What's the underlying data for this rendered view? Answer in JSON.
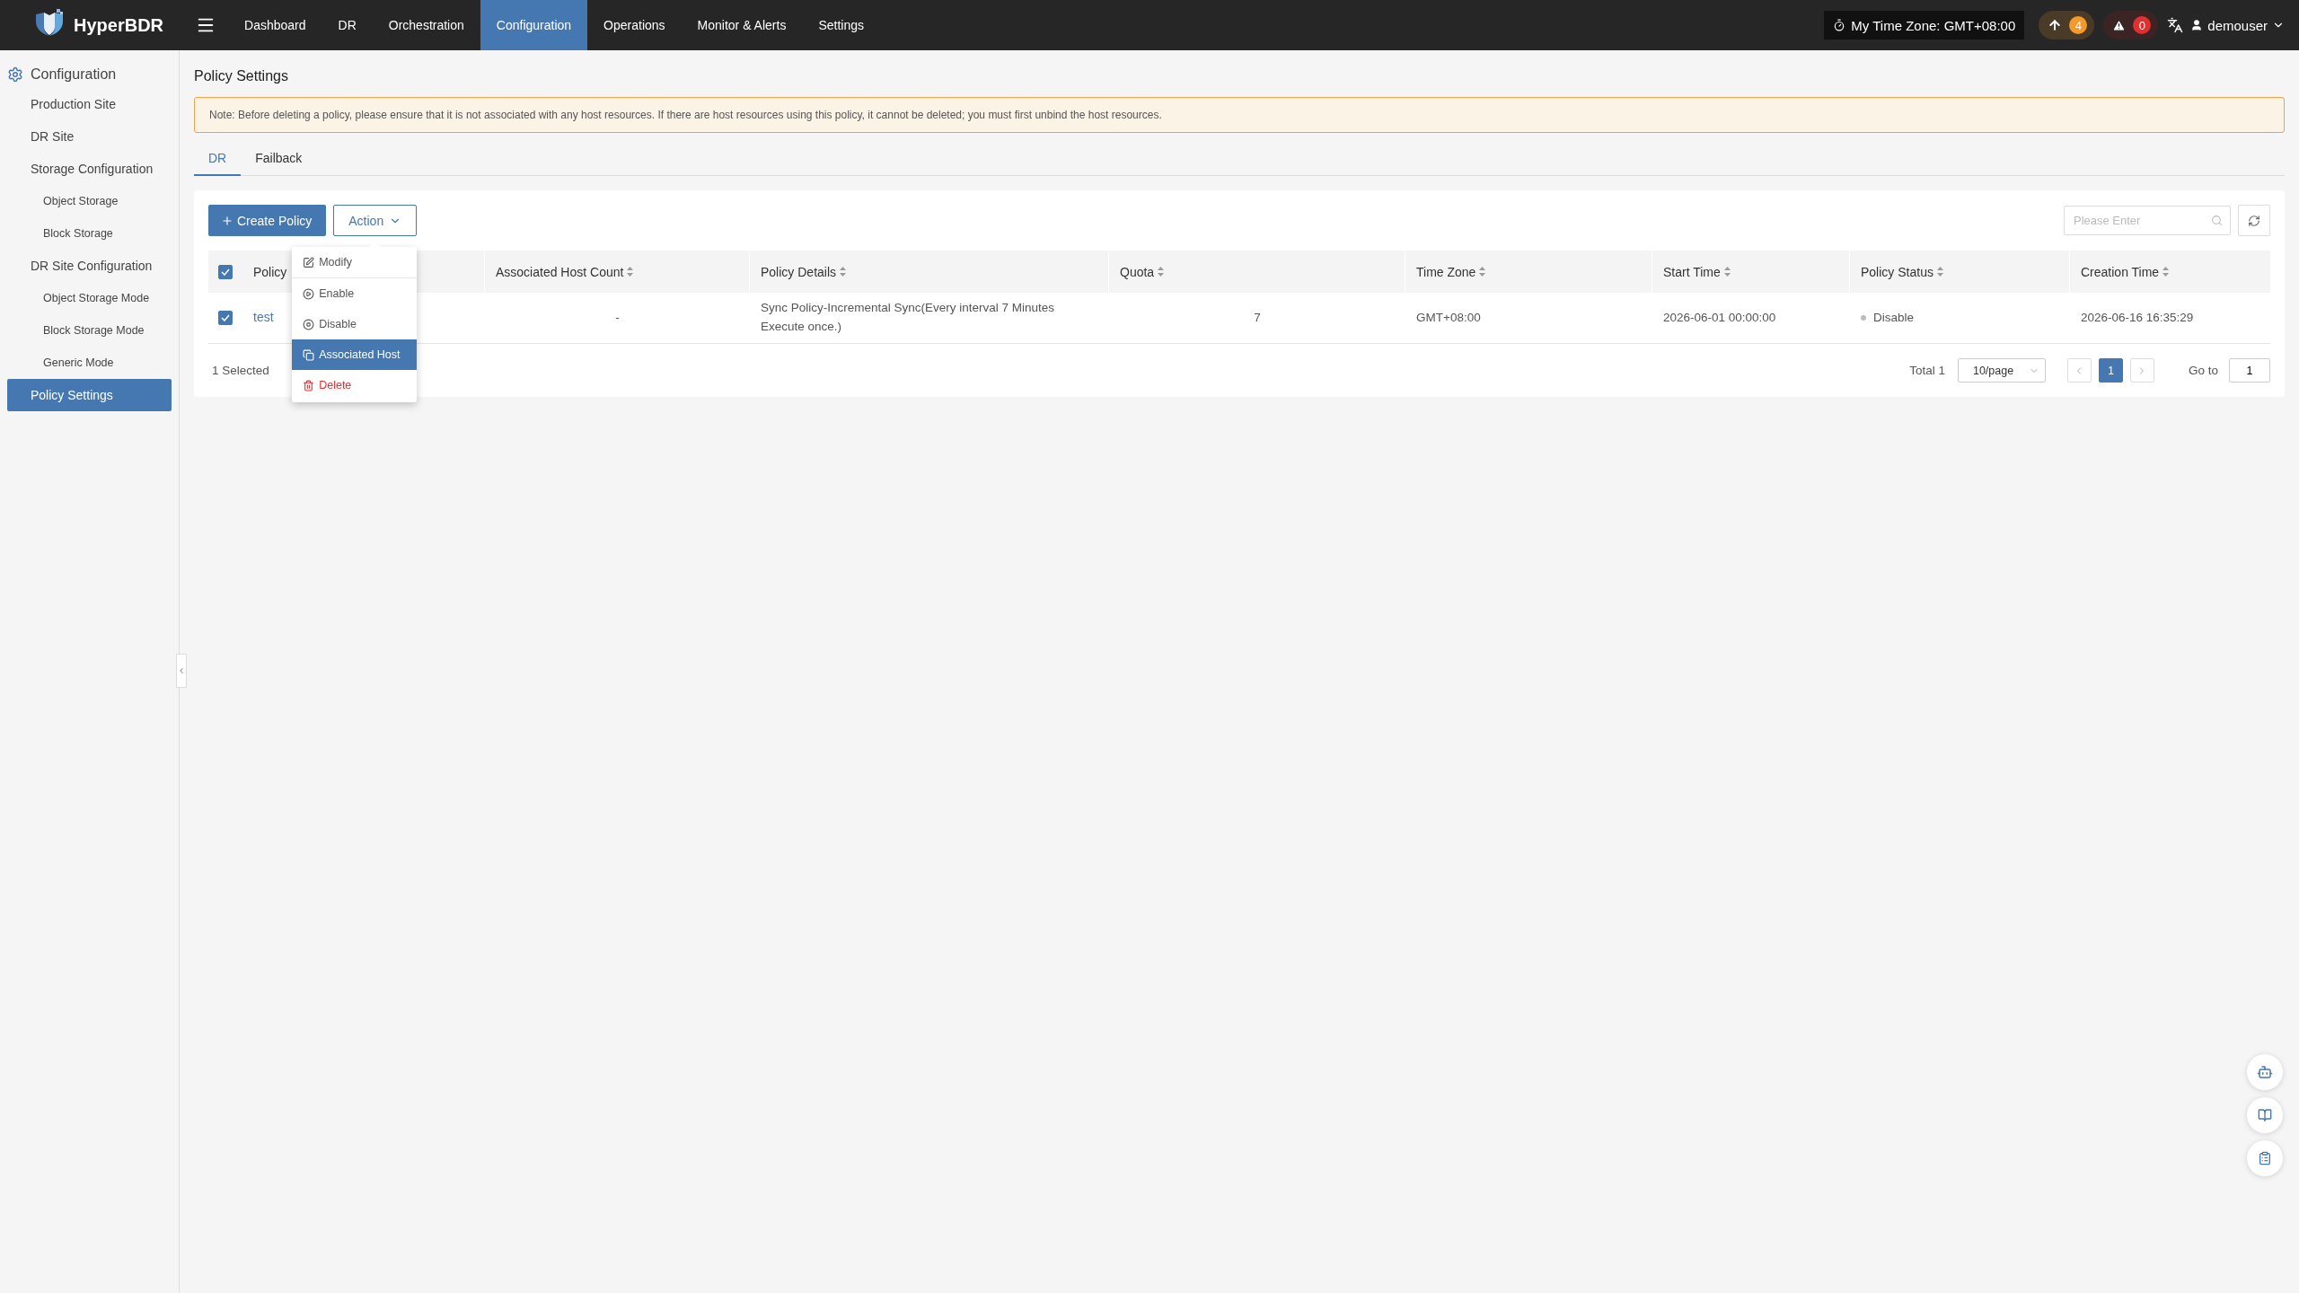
{
  "header": {
    "brand": "HyperBDR",
    "nav": [
      {
        "label": "Dashboard",
        "selected": false
      },
      {
        "label": "DR",
        "selected": false
      },
      {
        "label": "Orchestration",
        "selected": false
      },
      {
        "label": "Configuration",
        "selected": true
      },
      {
        "label": "Operations",
        "selected": false
      },
      {
        "label": "Monitor & Alerts",
        "selected": false
      },
      {
        "label": "Settings",
        "selected": false
      }
    ],
    "time_zone": "My Time Zone: GMT+08:00",
    "upload_count": "4",
    "alert_count": "0",
    "user": "demouser"
  },
  "sidebar": {
    "title": "Configuration",
    "items": [
      {
        "label": "Production Site",
        "selected": false
      },
      {
        "label": "DR Site",
        "selected": false
      },
      {
        "label": "Storage Configuration",
        "selected": false,
        "children": [
          {
            "label": "Object Storage",
            "selected": false
          },
          {
            "label": "Block Storage",
            "selected": false
          }
        ]
      },
      {
        "label": "DR Site Configuration",
        "selected": false,
        "children": [
          {
            "label": "Object Storage Mode",
            "selected": false
          },
          {
            "label": "Block Storage Mode",
            "selected": false
          },
          {
            "label": "Generic Mode",
            "selected": false
          }
        ]
      },
      {
        "label": "Policy Settings",
        "selected": true
      }
    ]
  },
  "page": {
    "title": "Policy Settings",
    "note": "Note: Before deleting a policy, please ensure that it is not associated with any host resources. If there are host resources using this policy, it cannot be deleted; you must first unbind the host resources.",
    "tabs": [
      {
        "label": "DR",
        "selected": true
      },
      {
        "label": "Failback",
        "selected": false
      }
    ],
    "toolbar": {
      "create_button": "Create Policy",
      "action_button": "Action",
      "search": {
        "placeholder": "Please Enter"
      }
    },
    "action_menu": [
      {
        "label": "Modify",
        "kind": "edit",
        "selected": false
      },
      {
        "label": "Enable",
        "kind": "enable",
        "selected": false
      },
      {
        "label": "Disable",
        "kind": "disable",
        "selected": false
      },
      {
        "label": "Associated Host",
        "kind": "associate",
        "selected": true
      },
      {
        "label": "Delete",
        "kind": "delete",
        "selected": false
      }
    ],
    "table": {
      "all_checked": true,
      "columns": [
        "Policy",
        "Associated Host Count",
        "Policy Details",
        "Quota",
        "Time Zone",
        "Start Time",
        "Policy Status",
        "Creation Time"
      ],
      "rows": [
        {
          "checked": true,
          "name": "test",
          "host_count": "-",
          "details": "Sync Policy-Incremental Sync(Every interval 7 Minutes Execute once.)",
          "quota": "7",
          "time_zone": "GMT+08:00",
          "start_time": "2026-06-01 00:00:00",
          "status": "Disable",
          "creation_time": "2026-06-16 16:35:29"
        }
      ]
    },
    "footer": {
      "selected_text": "1 Selected",
      "total": "Total 1",
      "page_size": "10/page",
      "pages": [
        {
          "label": "1",
          "selected": true
        }
      ],
      "goto_label": "Go to",
      "goto_value": "1"
    }
  }
}
